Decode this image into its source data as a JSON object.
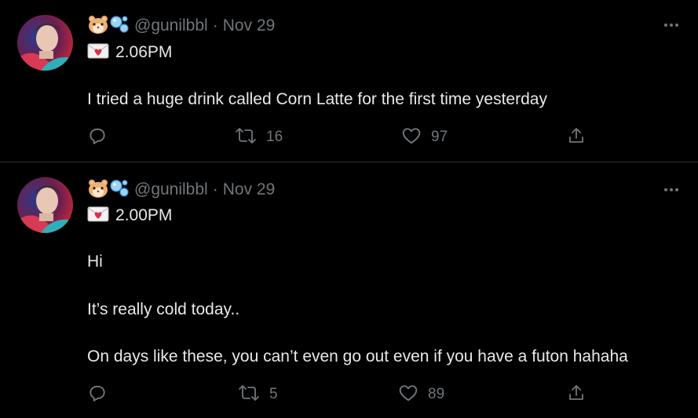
{
  "tweets": [
    {
      "handle": "@gunilbbl",
      "separator": "·",
      "date": "Nov 29",
      "emoji_prefix": "🐹🫧",
      "envelope": "💌",
      "display_time": "2.06PM",
      "text_lines": [
        "I tried a huge drink called Corn Latte for the first time yesterday"
      ],
      "retweets": "16",
      "likes": "97"
    },
    {
      "handle": "@gunilbbl",
      "separator": "·",
      "date": "Nov 29",
      "emoji_prefix": "🐹🫧",
      "envelope": "💌",
      "display_time": "2.00PM",
      "text_lines": [
        "Hi",
        "It’s really cold today..",
        "On days like these, you can’t even go out even if you have a futon hahaha"
      ],
      "retweets": "5",
      "likes": "89"
    }
  ],
  "colors": {
    "background": "#000000",
    "text_primary": "#e7e9ea",
    "text_secondary": "#71767b",
    "divider": "#2f3336"
  },
  "icons": [
    "hamster-icon",
    "bubbles-icon",
    "envelope-heart-icon",
    "reply-icon",
    "retweet-icon",
    "like-icon",
    "share-icon",
    "more-icon"
  ]
}
